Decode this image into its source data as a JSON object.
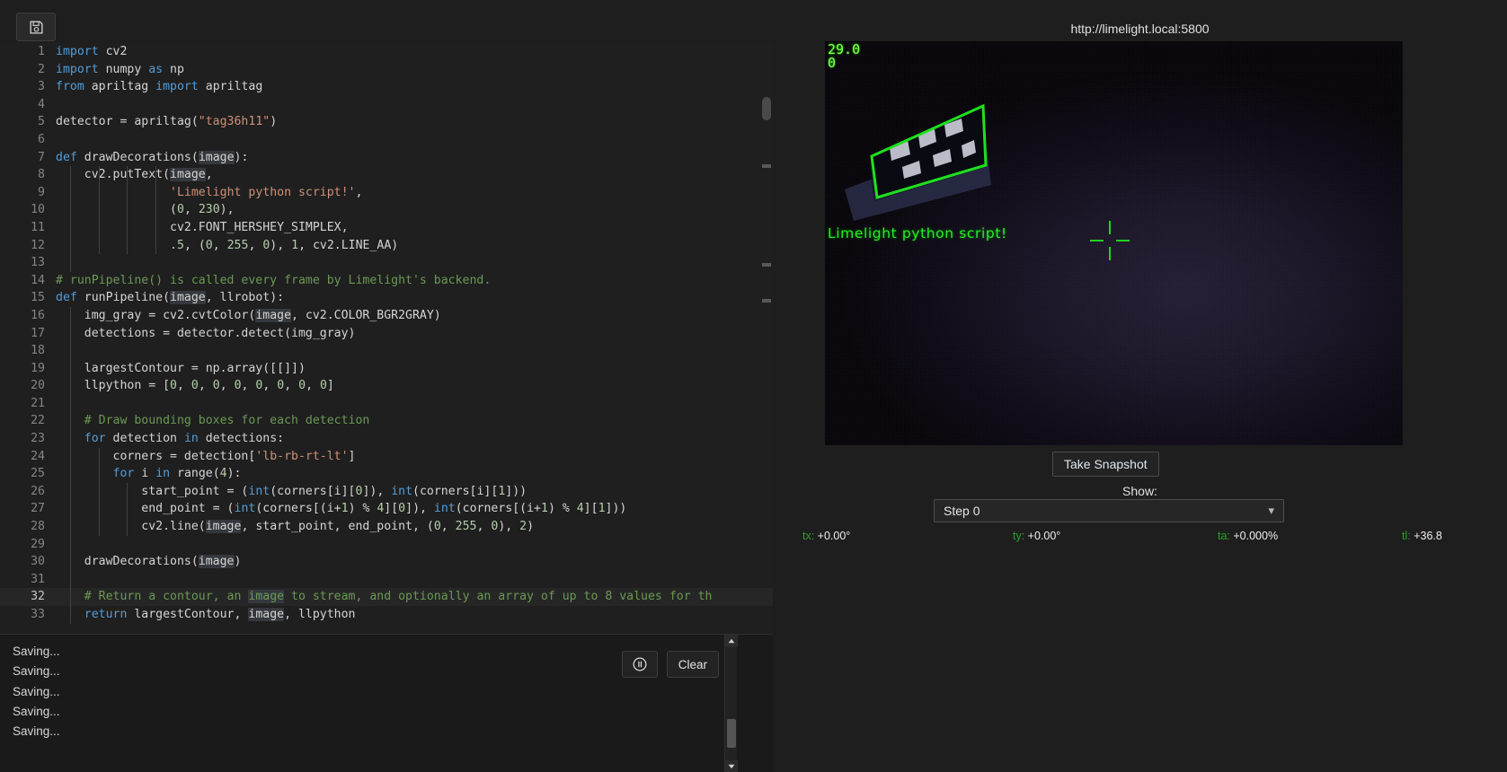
{
  "toolbar": {
    "save_icon": "save-disk-icon",
    "save_tooltip": "Save"
  },
  "editor": {
    "active_line": 32,
    "lines": [
      {
        "n": 1,
        "segs": [
          {
            "t": "import ",
            "c": "k"
          },
          {
            "t": "cv2",
            "c": "p"
          }
        ]
      },
      {
        "n": 2,
        "segs": [
          {
            "t": "import ",
            "c": "k"
          },
          {
            "t": "numpy ",
            "c": "p"
          },
          {
            "t": "as ",
            "c": "k"
          },
          {
            "t": "np",
            "c": "p"
          }
        ]
      },
      {
        "n": 3,
        "segs": [
          {
            "t": "from ",
            "c": "k"
          },
          {
            "t": "apriltag ",
            "c": "p"
          },
          {
            "t": "import ",
            "c": "k"
          },
          {
            "t": "apriltag",
            "c": "p"
          }
        ]
      },
      {
        "n": 4,
        "segs": []
      },
      {
        "n": 5,
        "segs": [
          {
            "t": "detector = apriltag(",
            "c": "p"
          },
          {
            "t": "\"tag36h11\"",
            "c": "s"
          },
          {
            "t": ")",
            "c": "p"
          }
        ]
      },
      {
        "n": 6,
        "segs": []
      },
      {
        "n": 7,
        "segs": [
          {
            "t": "def ",
            "c": "k"
          },
          {
            "t": "drawDecorations(",
            "c": "p"
          },
          {
            "t": "image",
            "c": "hl"
          },
          {
            "t": "):",
            "c": "p"
          }
        ]
      },
      {
        "n": 8,
        "segs": [
          {
            "t": "    cv2.putText(",
            "c": "p"
          },
          {
            "t": "image",
            "c": "hl"
          },
          {
            "t": ",",
            "c": "p"
          }
        ]
      },
      {
        "n": 9,
        "segs": [
          {
            "t": "                ",
            "c": "p"
          },
          {
            "t": "'Limelight python script!'",
            "c": "s"
          },
          {
            "t": ",",
            "c": "p"
          }
        ]
      },
      {
        "n": 10,
        "segs": [
          {
            "t": "                (",
            "c": "p"
          },
          {
            "t": "0",
            "c": "n"
          },
          {
            "t": ", ",
            "c": "p"
          },
          {
            "t": "230",
            "c": "n"
          },
          {
            "t": "),",
            "c": "p"
          }
        ]
      },
      {
        "n": 11,
        "segs": [
          {
            "t": "                cv2.FONT_HERSHEY_SIMPLEX,",
            "c": "p"
          }
        ]
      },
      {
        "n": 12,
        "segs": [
          {
            "t": "                ",
            "c": "p"
          },
          {
            "t": ".5",
            "c": "n"
          },
          {
            "t": ", (",
            "c": "p"
          },
          {
            "t": "0",
            "c": "n"
          },
          {
            "t": ", ",
            "c": "p"
          },
          {
            "t": "255",
            "c": "n"
          },
          {
            "t": ", ",
            "c": "p"
          },
          {
            "t": "0",
            "c": "n"
          },
          {
            "t": "), ",
            "c": "p"
          },
          {
            "t": "1",
            "c": "n"
          },
          {
            "t": ", cv2.LINE_AA)",
            "c": "p"
          }
        ]
      },
      {
        "n": 13,
        "segs": []
      },
      {
        "n": 14,
        "segs": [
          {
            "t": "# runPipeline() is called every frame by Limelight's backend.",
            "c": "c"
          }
        ]
      },
      {
        "n": 15,
        "segs": [
          {
            "t": "def ",
            "c": "k"
          },
          {
            "t": "runPipeline(",
            "c": "p"
          },
          {
            "t": "image",
            "c": "hl"
          },
          {
            "t": ", llrobot):",
            "c": "p"
          }
        ]
      },
      {
        "n": 16,
        "segs": [
          {
            "t": "    img_gray = cv2.cvtColor(",
            "c": "p"
          },
          {
            "t": "image",
            "c": "hl"
          },
          {
            "t": ", cv2.COLOR_BGR2GRAY)",
            "c": "p"
          }
        ]
      },
      {
        "n": 17,
        "segs": [
          {
            "t": "    detections = detector.detect(img_gray)",
            "c": "p"
          }
        ]
      },
      {
        "n": 18,
        "segs": []
      },
      {
        "n": 19,
        "segs": [
          {
            "t": "    largestContour = np.array([[]])",
            "c": "p"
          }
        ]
      },
      {
        "n": 20,
        "segs": [
          {
            "t": "    llpython = [",
            "c": "p"
          },
          {
            "t": "0",
            "c": "n"
          },
          {
            "t": ", ",
            "c": "p"
          },
          {
            "t": "0",
            "c": "n"
          },
          {
            "t": ", ",
            "c": "p"
          },
          {
            "t": "0",
            "c": "n"
          },
          {
            "t": ", ",
            "c": "p"
          },
          {
            "t": "0",
            "c": "n"
          },
          {
            "t": ", ",
            "c": "p"
          },
          {
            "t": "0",
            "c": "n"
          },
          {
            "t": ", ",
            "c": "p"
          },
          {
            "t": "0",
            "c": "n"
          },
          {
            "t": ", ",
            "c": "p"
          },
          {
            "t": "0",
            "c": "n"
          },
          {
            "t": ", ",
            "c": "p"
          },
          {
            "t": "0",
            "c": "n"
          },
          {
            "t": "]",
            "c": "p"
          }
        ]
      },
      {
        "n": 21,
        "segs": []
      },
      {
        "n": 22,
        "segs": [
          {
            "t": "    # Draw bounding boxes for each detection",
            "c": "c"
          }
        ]
      },
      {
        "n": 23,
        "segs": [
          {
            "t": "    ",
            "c": "p"
          },
          {
            "t": "for ",
            "c": "k"
          },
          {
            "t": "detection ",
            "c": "p"
          },
          {
            "t": "in ",
            "c": "k"
          },
          {
            "t": "detections:",
            "c": "p"
          }
        ]
      },
      {
        "n": 24,
        "segs": [
          {
            "t": "        corners = detection[",
            "c": "p"
          },
          {
            "t": "'lb-rb-rt-lt'",
            "c": "s"
          },
          {
            "t": "]",
            "c": "p"
          }
        ]
      },
      {
        "n": 25,
        "segs": [
          {
            "t": "        ",
            "c": "p"
          },
          {
            "t": "for ",
            "c": "k"
          },
          {
            "t": "i ",
            "c": "p"
          },
          {
            "t": "in ",
            "c": "k"
          },
          {
            "t": "range(",
            "c": "p"
          },
          {
            "t": "4",
            "c": "n"
          },
          {
            "t": "):",
            "c": "p"
          }
        ]
      },
      {
        "n": 26,
        "segs": [
          {
            "t": "            start_point = (",
            "c": "p"
          },
          {
            "t": "int",
            "c": "k"
          },
          {
            "t": "(corners[i][",
            "c": "p"
          },
          {
            "t": "0",
            "c": "n"
          },
          {
            "t": "]), ",
            "c": "p"
          },
          {
            "t": "int",
            "c": "k"
          },
          {
            "t": "(corners[i][",
            "c": "p"
          },
          {
            "t": "1",
            "c": "n"
          },
          {
            "t": "]))",
            "c": "p"
          }
        ]
      },
      {
        "n": 27,
        "segs": [
          {
            "t": "            end_point = (",
            "c": "p"
          },
          {
            "t": "int",
            "c": "k"
          },
          {
            "t": "(corners[(i+",
            "c": "p"
          },
          {
            "t": "1",
            "c": "n"
          },
          {
            "t": ") % ",
            "c": "p"
          },
          {
            "t": "4",
            "c": "n"
          },
          {
            "t": "][",
            "c": "p"
          },
          {
            "t": "0",
            "c": "n"
          },
          {
            "t": "]), ",
            "c": "p"
          },
          {
            "t": "int",
            "c": "k"
          },
          {
            "t": "(corners[(i+",
            "c": "p"
          },
          {
            "t": "1",
            "c": "n"
          },
          {
            "t": ") % ",
            "c": "p"
          },
          {
            "t": "4",
            "c": "n"
          },
          {
            "t": "][",
            "c": "p"
          },
          {
            "t": "1",
            "c": "n"
          },
          {
            "t": "]))",
            "c": "p"
          }
        ]
      },
      {
        "n": 28,
        "segs": [
          {
            "t": "            cv2.line(",
            "c": "p"
          },
          {
            "t": "image",
            "c": "hl"
          },
          {
            "t": ", start_point, end_point, (",
            "c": "p"
          },
          {
            "t": "0",
            "c": "n"
          },
          {
            "t": ", ",
            "c": "p"
          },
          {
            "t": "255",
            "c": "n"
          },
          {
            "t": ", ",
            "c": "p"
          },
          {
            "t": "0",
            "c": "n"
          },
          {
            "t": "), ",
            "c": "p"
          },
          {
            "t": "2",
            "c": "n"
          },
          {
            "t": ")",
            "c": "p"
          }
        ]
      },
      {
        "n": 29,
        "segs": []
      },
      {
        "n": 30,
        "segs": [
          {
            "t": "    drawDecorations(",
            "c": "p"
          },
          {
            "t": "image",
            "c": "hl"
          },
          {
            "t": ")",
            "c": "p"
          }
        ]
      },
      {
        "n": 31,
        "segs": []
      },
      {
        "n": 32,
        "segs": [
          {
            "t": "    # Return a contour, an ",
            "c": "c"
          },
          {
            "t": "image",
            "c": "hl c"
          },
          {
            "t": " to stream, and optionally an array of up to 8 values for th",
            "c": "c"
          }
        ]
      },
      {
        "n": 33,
        "segs": [
          {
            "t": "    ",
            "c": "p"
          },
          {
            "t": "return ",
            "c": "k"
          },
          {
            "t": "largestContour, ",
            "c": "p"
          },
          {
            "t": "image",
            "c": "hl"
          },
          {
            "t": ", llpython",
            "c": "p"
          }
        ]
      }
    ]
  },
  "console": {
    "lines": [
      "Saving...",
      "Saving...",
      "Saving...",
      "Saving...",
      "Saving..."
    ],
    "pause_icon": "pause-circle-icon",
    "clear_label": "Clear"
  },
  "stream": {
    "url": "http://limelight.local:5800",
    "fps_line1": "29.0",
    "fps_line2": "0",
    "overlay_text": "Limelight python script!",
    "crosshair_icon": "crosshair-icon",
    "snapshot_label": "Take Snapshot",
    "show_label": "Show:",
    "step_value": "Step 0",
    "step_chevron": "chevron-down-icon",
    "status": [
      {
        "key": "tx:",
        "value": "+0.00°"
      },
      {
        "key": "ty:",
        "value": "+0.00°"
      },
      {
        "key": "ta:",
        "value": "+0.000%"
      },
      {
        "key": "tl:",
        "value": "+36.8"
      }
    ]
  },
  "colors": {
    "accent_green": "#2f9e2f",
    "overlay_green": "#22ee22",
    "bg": "#1e1e1e",
    "editor_bg": "#1f1f1f"
  }
}
